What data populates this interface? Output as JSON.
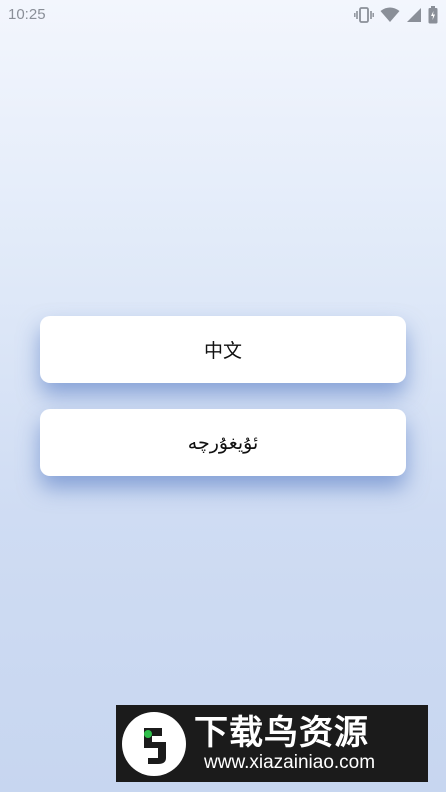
{
  "status_bar": {
    "time": "10:25",
    "icons": [
      "vibrate-icon",
      "wifi-icon",
      "signal-icon",
      "battery-icon"
    ]
  },
  "language_buttons": [
    {
      "id": "zh",
      "label": "中文"
    },
    {
      "id": "ug",
      "label": "ئۇيغۇرچە"
    }
  ],
  "watermark": {
    "title": "下载鸟资源",
    "url": "www.xiazainiao.com"
  },
  "colors": {
    "background_top": "#f3f6fd",
    "background_bottom": "#c7d6f0",
    "button_bg": "#ffffff",
    "button_shadow": "#466ebe",
    "status_text": "#8a8f98"
  }
}
